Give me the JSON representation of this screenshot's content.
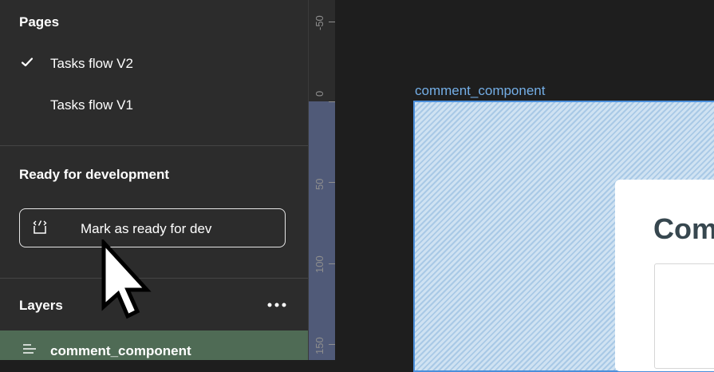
{
  "sidebar": {
    "pages_title": "Pages",
    "pages": [
      {
        "label": "Tasks flow V2",
        "selected": true
      },
      {
        "label": "Tasks flow V1",
        "selected": false
      }
    ],
    "ready_title": "Ready for development",
    "ready_button_label": "Mark as ready for dev",
    "layers_title": "Layers",
    "layers": [
      {
        "label": "comment_component",
        "selected": true
      }
    ]
  },
  "ruler": {
    "labels": [
      "-50",
      "0",
      "50",
      "100",
      "150"
    ]
  },
  "canvas": {
    "frame_label": "comment_component",
    "card_title": "Com"
  },
  "colors": {
    "sidebar_bg": "#2c2c2c",
    "layer_selected_bg": "#4f6b55",
    "frame_accent": "#4b8fdb",
    "ruler_selection": "#505a78"
  }
}
